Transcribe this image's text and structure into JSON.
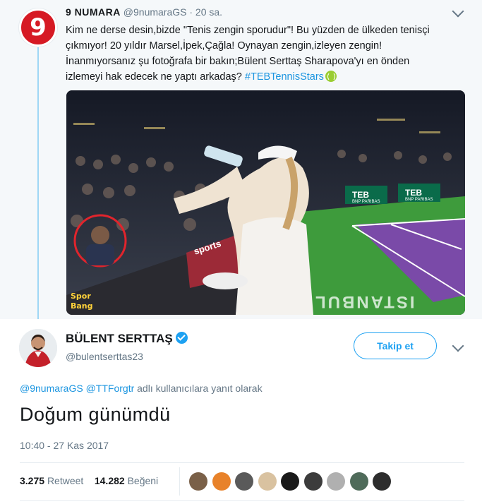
{
  "parent_tweet": {
    "avatar_text": "9",
    "display_name": "9 NUMARA",
    "handle": "@9numaraGS",
    "time": "· 20 sa.",
    "text_lines": [
      "Kim ne derse desin,bizde \"Tenis zengin sporudur\"! Bu yüzden de ülkeden tenisçi",
      "çıkmıyor! 20 yıldır Marsel,İpek,Çağla! Oynayan zengin,izleyen zengin!",
      "İnanmıyorsanız şu fotoğrafa  bir bakın;Bülent Serttaş Sharapova'yı en önden",
      "izlemeyi hak edecek ne yaptı arkadaş?"
    ],
    "hashtag": "#TEBTennisStars",
    "photo": {
      "sponsor_left": "TEB",
      "sponsor_left_sub": "BNP PARIBAS",
      "sponsor_right": "TEB",
      "sponsor_right_sub": "BNP PARIBAS",
      "court_text": "ISTANBUL",
      "broadcaster": "sports",
      "watermark_line1": "Spor",
      "watermark_line2": "Bang",
      "circle_color": "#e0242c"
    }
  },
  "tweet": {
    "display_name": "BÜLENT SERTTAŞ",
    "handle": "@bulentserttas23",
    "follow_label": "Takip et",
    "reply_to": {
      "mention1": "@9numaraGS",
      "mention2": "@TTForgtr",
      "suffix": "adlı kullanıcılara yanıt olarak"
    },
    "text": "Doğum günümdü",
    "timestamp": "10:40 - 27 Kas 2017",
    "retweets": {
      "count": "3.275",
      "label": "Retweet"
    },
    "likes": {
      "count": "14.282",
      "label": "Beğeni"
    },
    "liker_colors": [
      "#7a6048",
      "#e8822a",
      "#5a5a5a",
      "#d9c2a0",
      "#1a1a1a",
      "#3c3c3c",
      "#b0b0b0",
      "#4f6b5a",
      "#2d2d2d"
    ]
  },
  "colors": {
    "accent": "#1da1f2",
    "link": "#1b95e0",
    "muted": "#657786",
    "avatar_red": "#d61a24",
    "court_green": "#3e9b3c",
    "court_purple": "#7a4aa8"
  }
}
